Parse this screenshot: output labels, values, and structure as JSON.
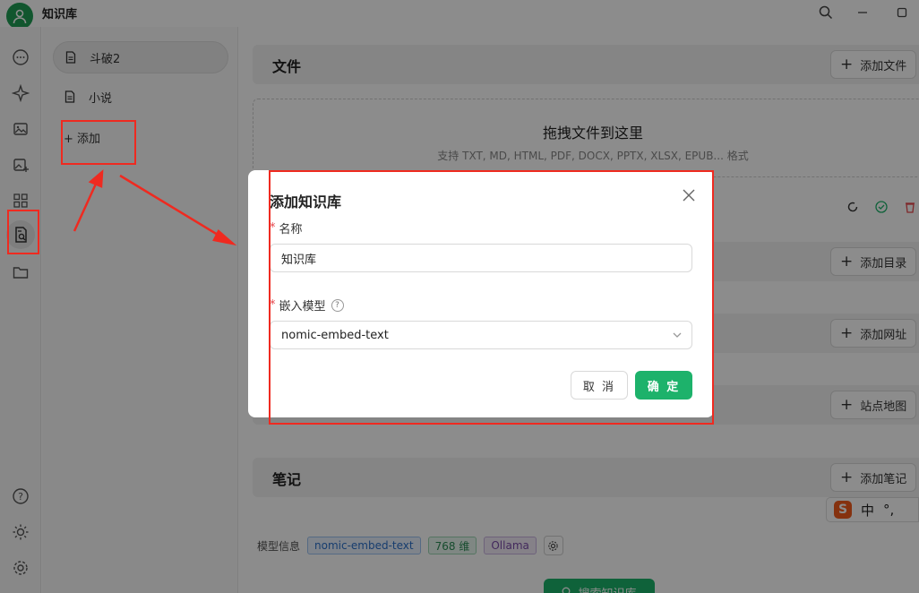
{
  "app": {
    "title": "知识库"
  },
  "kb_list": {
    "items": [
      {
        "label": "斗破2",
        "selected": true
      },
      {
        "label": "小说",
        "selected": false
      }
    ],
    "add_label": "+ 添加"
  },
  "sections": {
    "files": {
      "title": "文件",
      "button": "添加文件"
    },
    "dropzone": {
      "title": "拖拽文件到这里",
      "subtitle": "支持 TXT, MD, HTML, PDF, DOCX, PPTX, XLSX, EPUB... 格式"
    },
    "directory": {
      "button": "添加目录"
    },
    "url": {
      "button": "添加网址"
    },
    "sitemap": {
      "button": "站点地图"
    },
    "notes": {
      "title": "笔记",
      "button": "添加笔记"
    }
  },
  "model_info": {
    "label": "模型信息",
    "model": "nomic-embed-text",
    "dims": "768 维",
    "provider": "Ollama"
  },
  "search_button": "搜索知识库",
  "ime": {
    "mode": "中",
    "punct": "°,"
  },
  "modal": {
    "title": "添加知识库",
    "name_label": "名称",
    "name_value": "知识库",
    "model_label": "嵌入模型",
    "model_value": "nomic-embed-text",
    "cancel": "取 消",
    "ok": "确 定"
  },
  "colors": {
    "accent": "#1db26b",
    "annotation": "#ef2a20"
  }
}
